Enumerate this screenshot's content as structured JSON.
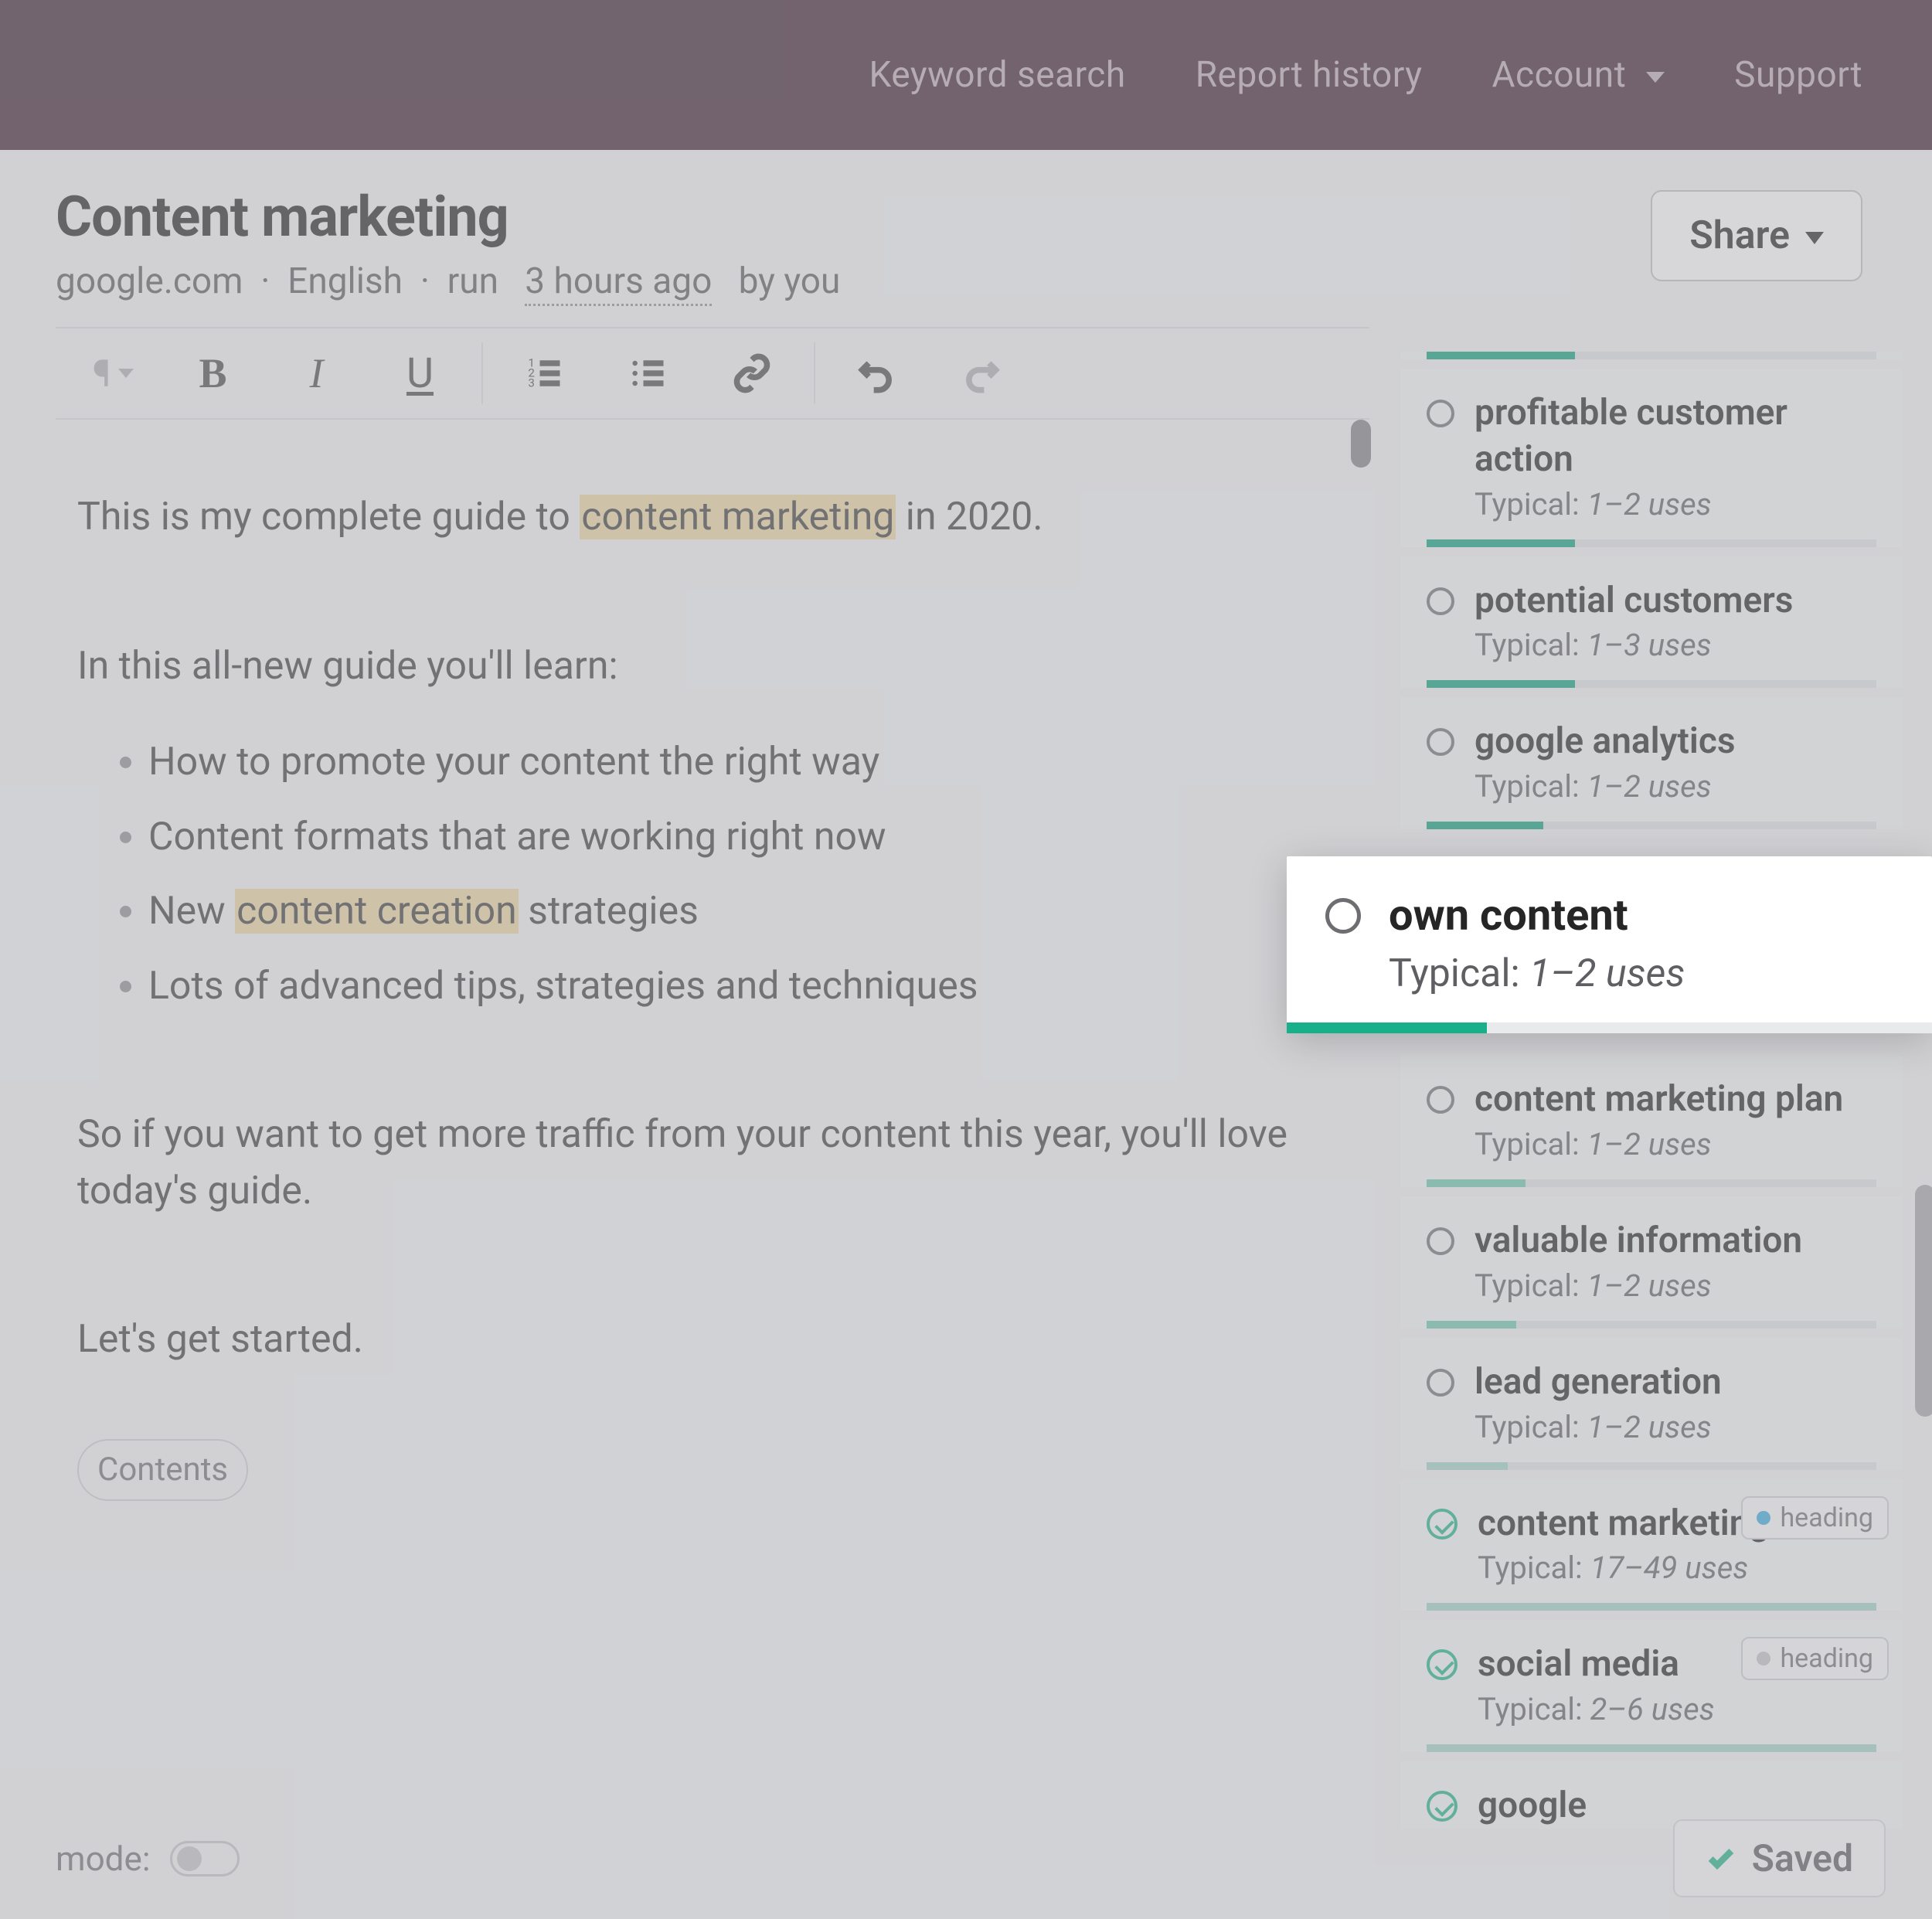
{
  "nav": {
    "keyword_search": "Keyword search",
    "report_history": "Report history",
    "account": "Account",
    "support": "Support"
  },
  "header": {
    "title": "Content marketing",
    "domain": "google.com",
    "lang": "English",
    "run_prefix": "run",
    "run_time": "3 hours ago",
    "run_suffix": "by you",
    "share": "Share"
  },
  "editor": {
    "para1_a": "This is my complete guide to ",
    "para1_hl": "content marketing",
    "para1_b": " in 2020.",
    "para2": "In this all-new guide you'll learn:",
    "bullets": {
      "b0": "How to promote your content the right way",
      "b1": "Content formats that are working right now",
      "b2_a": "New ",
      "b2_hl": "content creation",
      "b2_b": " strategies",
      "b3": "Lots of advanced tips, strategies and techniques"
    },
    "para3": "So if you want to get more traffic from your content this year, you'll love today's guide.",
    "para4": "Let's get started.",
    "contents": "Contents"
  },
  "footer": {
    "mode": "mode:",
    "saved": "Saved"
  },
  "keywords": [
    {
      "label": "profitable customer action",
      "typical": "1–2 uses",
      "fill": 33,
      "tone": "dark",
      "status": "open"
    },
    {
      "label": "potential customers",
      "typical": "1–3 uses",
      "fill": 33,
      "tone": "dark",
      "status": "open"
    },
    {
      "label": "google analytics",
      "typical": "1–2 uses",
      "fill": 26,
      "tone": "dark",
      "status": "open"
    },
    {
      "label": "own content",
      "typical": "1–2 uses",
      "fill": 31,
      "tone": "dark",
      "status": "open",
      "popout": true
    },
    {
      "label": "content marketing plan",
      "typical": "1–2 uses",
      "fill": 22,
      "tone": "light",
      "status": "open"
    },
    {
      "label": "valuable information",
      "typical": "1–2 uses",
      "fill": 20,
      "tone": "light",
      "status": "open"
    },
    {
      "label": "lead generation",
      "typical": "1–2 uses",
      "fill": 18,
      "tone": "lighter",
      "status": "open"
    },
    {
      "label": "content marketing",
      "typical": "17–49 uses",
      "fill": 100,
      "tone": "lighter",
      "status": "done",
      "badge": "heading",
      "badge_tone": "blue"
    },
    {
      "label": "social media",
      "typical": "2–6 uses",
      "fill": 100,
      "tone": "lighter",
      "status": "done",
      "badge": "heading",
      "badge_tone": "gray"
    },
    {
      "label": "google",
      "typical": "",
      "fill": 0,
      "tone": "lighter",
      "status": "done"
    }
  ],
  "typ_prefix": "Typical: "
}
